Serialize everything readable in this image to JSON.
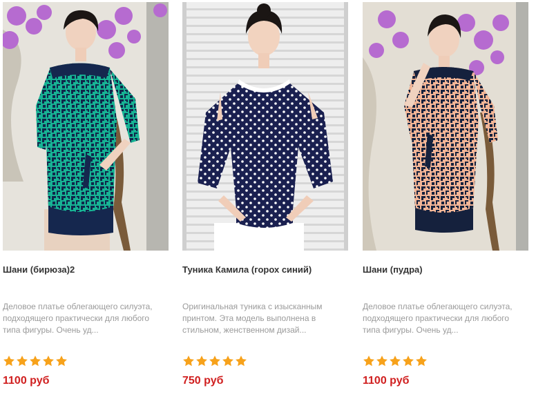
{
  "products": [
    {
      "title": "Шани (бирюза)2",
      "description": "Деловое платье облегающего силуэта, подходящего практически для любого типа фигуры. Очень уд...",
      "rating": 5,
      "price": "1100 руб",
      "image_alt": "Model in turquoise and navy geometric print dress"
    },
    {
      "title": "Туника Камила (горох синий)",
      "description": "Оригинальная туника с изысканным принтом. Эта модель выполнена в стильном, женственном дизай...",
      "rating": 5,
      "price": "750 руб",
      "image_alt": "Model in navy polka dot tunic"
    },
    {
      "title": "Шани (пудра)",
      "description": "Деловое платье облегающего силуэта, подходящего практически для любого типа фигуры. Очень уд...",
      "rating": 5,
      "price": "1100 руб",
      "image_alt": "Model in powder pink and navy geometric print dress"
    }
  ],
  "colors": {
    "price": "#d01f1f",
    "star": "#f7a21b",
    "title": "#333333",
    "description": "#9a9a9a"
  },
  "icons": {
    "rating_star": "star-icon"
  }
}
